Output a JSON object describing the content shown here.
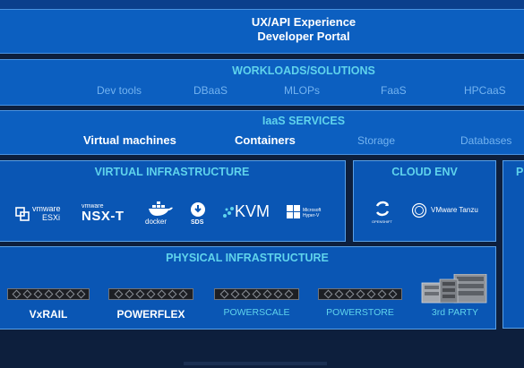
{
  "portal": {
    "line1": "UX/API Experience",
    "line2": "Developer Portal"
  },
  "workloads": {
    "title": "WORKLOADS/SOLUTIONS",
    "items": [
      "Dev tools",
      "DBaaS",
      "MLOPs",
      "FaaS",
      "HPCaaS"
    ]
  },
  "iaas": {
    "title": "IaaS SERVICES",
    "items": [
      {
        "label": "Virtual machines",
        "emphasis": true
      },
      {
        "label": "Containers",
        "emphasis": true
      },
      {
        "label": "Storage",
        "emphasis": false
      },
      {
        "label": "Databases",
        "emphasis": false
      }
    ]
  },
  "virtual_infra": {
    "title": "VIRTUAL INFRASTRUCTURE",
    "logos": [
      {
        "icon": "vmware-esxi-logo",
        "text_top": "vmware",
        "text_bottom": "ESXi"
      },
      {
        "icon": "nsx-t-logo",
        "text_top": "vmware",
        "text_bottom": "NSX-T"
      },
      {
        "icon": "docker-logo",
        "text": "docker"
      },
      {
        "icon": "sds-logo",
        "text": "SDS"
      },
      {
        "icon": "kvm-logo",
        "text": "KVM"
      },
      {
        "icon": "microsoft-hyperv-logo",
        "text": "Microsoft Hyper-V"
      }
    ]
  },
  "cloud_env": {
    "title": "CLOUD ENV",
    "logos": [
      {
        "icon": "openshift-logo",
        "text": "OPENSHIFT"
      },
      {
        "icon": "vmware-tanzu-logo",
        "text": "VMware Tanzu"
      }
    ]
  },
  "right_panel": {
    "title": "P"
  },
  "physical_infra": {
    "title": "PHYSICAL INFRASTRUCTURE",
    "products": [
      {
        "label": "VxRAIL",
        "emphasis": true
      },
      {
        "label": "POWERFLEX",
        "emphasis": true
      },
      {
        "label": "POWERSCALE",
        "emphasis": false
      },
      {
        "label": "POWERSTORE",
        "emphasis": false
      },
      {
        "label": "3rd PARTY",
        "emphasis": false
      }
    ]
  },
  "colors": {
    "background": "#0d1f3d",
    "band": "#0c5fc0",
    "cyan_title": "#5fd3ec",
    "dim_text": "#73b3f0"
  }
}
